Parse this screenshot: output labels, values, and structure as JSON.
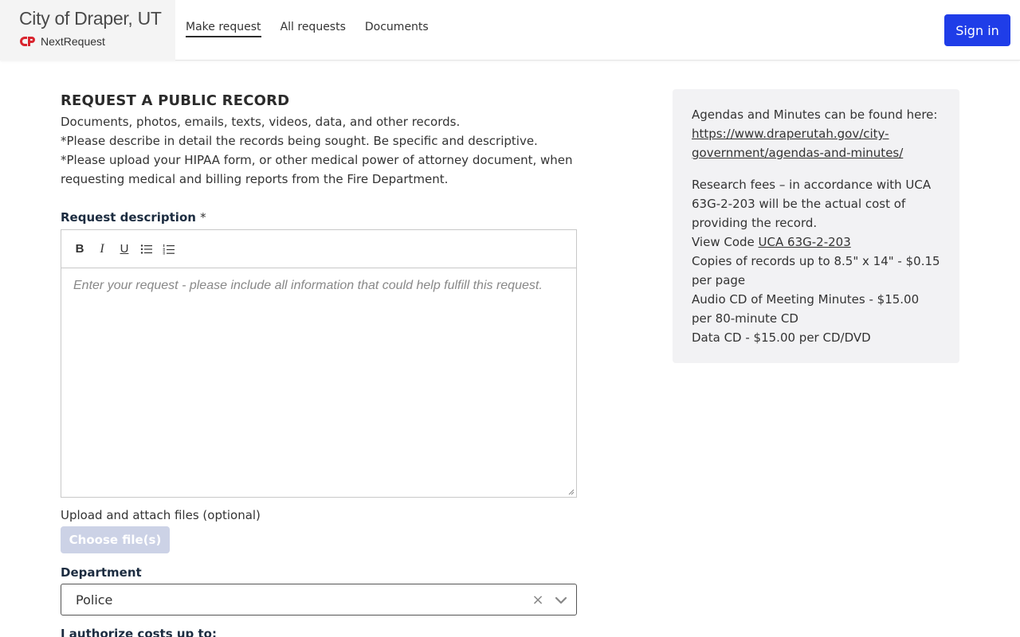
{
  "header": {
    "agency_name": "City of Draper, UT",
    "brand_name": "NextRequest",
    "nav": [
      {
        "label": "Make request"
      },
      {
        "label": "All requests"
      },
      {
        "label": "Documents"
      }
    ],
    "sign_in_label": "Sign in"
  },
  "form": {
    "title": "REQUEST A PUBLIC RECORD",
    "intro": [
      "Documents, photos, emails, texts, videos, data, and other records.",
      "*Please describe in detail the records being sought. Be specific and descriptive.",
      "*Please upload your HIPAA form, or other medical power of attorney document, when requesting medical and billing reports from the Fire Department."
    ],
    "description_label": "Request description",
    "required_marker": "*",
    "toolbar": {
      "bold": "B",
      "italic": "I",
      "underline": "U"
    },
    "description_placeholder": "Enter your request - please include all information that could help fulfill this request.",
    "description_value": "",
    "upload_label": "Upload and attach files (optional)",
    "choose_files_label": "Choose file(s)",
    "department_label": "Department",
    "department_value": "Police",
    "department_clear": "×",
    "authorize_label": "I authorize costs up to:"
  },
  "sidebar": {
    "agendas_text": "Agendas and Minutes can be found here: ",
    "agendas_link": "https://www.draperutah.gov/city-government/agendas-and-minutes/",
    "fees_text": "Research fees – in accordance with UCA 63G-2-203 will be the actual cost of providing the record.",
    "view_code_text": "View Code ",
    "view_code_link": "UCA 63G-2-203",
    "copies_text": "Copies of records up to 8.5\" x 14\" - $0.15 per page",
    "audio_text": "Audio CD of Meeting Minutes - $15.00 per 80-minute CD",
    "data_cd_text": "Data CD - $15.00 per CD/DVD"
  },
  "colors": {
    "primary_button": "#1f3de8",
    "disabled_button": "#ccd2e6",
    "brand_red": "#d9252f",
    "sidebar_bg": "#f2f2f4"
  }
}
